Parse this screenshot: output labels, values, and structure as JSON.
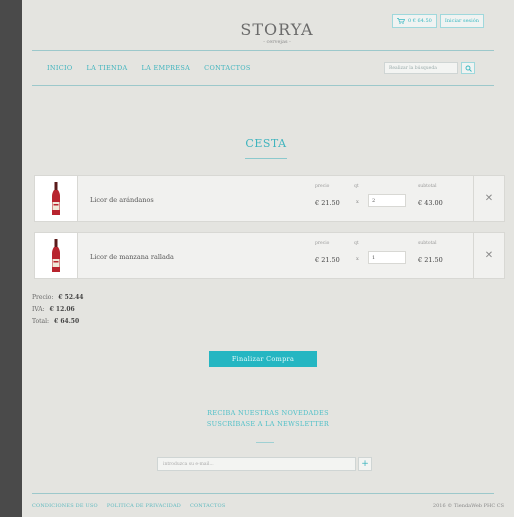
{
  "header": {
    "logo_name": "STORYA",
    "logo_tagline": "- cervejas -",
    "cart_label": "0 € 64.50",
    "login_label": "Iniciar sesión"
  },
  "nav": {
    "items": [
      "INICIO",
      "LA TIENDA",
      "LA EMPRESA",
      "CONTACTOS"
    ]
  },
  "search": {
    "placeholder": "Realizar la búsqueda"
  },
  "cart": {
    "title": "CESTA",
    "columns": {
      "price": "precio",
      "qty": "qt",
      "subtotal": "subtotal"
    },
    "qty_separator": "x",
    "items": [
      {
        "name": "Licor de arándanos",
        "price": "€ 21.50",
        "qty": "2",
        "subtotal": "€ 43.00"
      },
      {
        "name": "Licor de manzana rallada",
        "price": "€ 21.50",
        "qty": "1",
        "subtotal": "€ 21.50"
      }
    ],
    "remove_icon": "✕"
  },
  "totals": {
    "price_label": "Precio:",
    "price_value": "€ 52.44",
    "iva_label": "IVA:",
    "iva_value": "€ 12.06",
    "total_label": "Total:",
    "total_value": "€ 64.50"
  },
  "checkout": {
    "label": "Finalizar Compra"
  },
  "newsletter": {
    "line1": "RECIBA NUESTRAS NOVEDADES",
    "line2": "SUSCRÍBASE A LA NEWSLETTER",
    "placeholder": "introduzca su e-mail...",
    "submit_symbol": "+"
  },
  "footer": {
    "links": [
      "CONDICIONES DE USO",
      "POLITICA DE PRIVACIDAD",
      "CONTACTOS"
    ],
    "copyright": "2016 © TiendaWeb PHC CS"
  },
  "colors": {
    "accent": "#25b6c2",
    "background": "#e4e4e0"
  }
}
